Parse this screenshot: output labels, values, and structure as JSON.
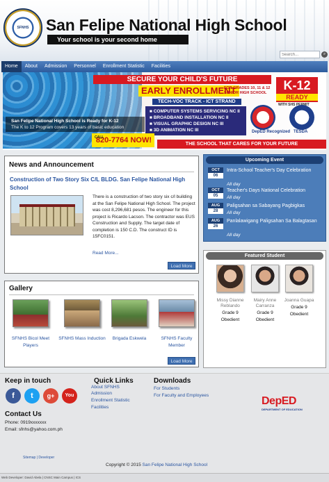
{
  "header": {
    "school_name": "San Felipe National High School",
    "tagline": "Your school is your second home",
    "search_placeholder": "Search..."
  },
  "nav": [
    "Home",
    "About",
    "Admission",
    "Personnel",
    "Enrollment Statistic",
    "Facilities"
  ],
  "banner": {
    "headline": "SECURE YOUR CHILD'S FUTURE",
    "early": "EARLY ENROLLMENT",
    "grades": "FOR GRADES 10, 11 & 12 SENIOR HIGH SCHOOL",
    "k12": "K-12",
    "k12_sub": "READY",
    "shs": "WITH SHS PERMIT",
    "strand": "TECH-VOC TRACK - ICT STRAND",
    "courses": [
      "COMPUTER SYSTEMS SERVICING NC II",
      "BROADBAND INSTALLATION NC II",
      "VISUAL GRAPHIC DESIGN NC III",
      "3D ANIMATION NC III"
    ],
    "call_label": "CALL",
    "phone": "820-7764 NOW!",
    "bottom": "THE SCHOOL THAT CARES FOR YOUR FUTURE",
    "deped_label": "DepED Recognized",
    "tesda_label": "TESDA",
    "uca_label": "UCA",
    "caption_title": "San Felipe National High School is Ready for K-12",
    "caption_sub": "The K to 12 Program covers 13 years of basic education"
  },
  "news": {
    "heading": "News and Announcement",
    "title": "Construction of Two Story Six C/L BLDG. San Felipe National High School",
    "body": "There is a construction of two story six c/l building at the San Felipe National High School. The project was cost 8,296,681 pesos. The engineer for this project is Ricardo Lacson. The contractor was EUS Construction and Supply. The target date of completion is 150 C.D. The construct ID is 15FC0151.",
    "read_more": "Read More...",
    "load_more": "Load More"
  },
  "gallery": {
    "heading": "Gallery",
    "items": [
      {
        "label": "SFNHS Bicol Meet Players"
      },
      {
        "label": "SFNHS Mass Induction"
      },
      {
        "label": "Brigada Eskwela"
      },
      {
        "label": "SFNHS Faculty Member"
      }
    ],
    "load_more": "Load More"
  },
  "events": {
    "heading": "Upcoming Event",
    "items": [
      {
        "month": "OCT",
        "day": "06",
        "title": "Intra-School Teacher's Day Celebration",
        "time": "All day"
      },
      {
        "month": "OCT",
        "day": "05",
        "title": "Teacher's Days National Celebration",
        "time": "All day"
      },
      {
        "month": "AUG",
        "day": "28",
        "title": "Paligsahan sa Sabayang Pagbigkas",
        "time": "All day"
      },
      {
        "month": "AUG",
        "day": "26",
        "title": "Panlalawigang Paligsahan Sa Balagtasan",
        "time": "All day"
      }
    ]
  },
  "featured": {
    "heading": "Featured Student",
    "students": [
      {
        "name": "Missy Dianne Reblando",
        "grade": "Grade 9",
        "status": "Obedient"
      },
      {
        "name": "Mairy Anne Carranza",
        "grade": "Grade 9",
        "status": "Obedient"
      },
      {
        "name": "Joanna Guapa",
        "grade": "Grade 9",
        "status": "Obedient"
      }
    ]
  },
  "footer": {
    "keep_in_touch": "Keep in touch",
    "quick_links": "Quick Links",
    "quick_items": [
      "About SFNHS",
      "Admission",
      "Enrollment Statistic",
      "Facilities"
    ],
    "downloads": "Downloads",
    "download_items": [
      "For Students",
      "For Faculty and Employees"
    ],
    "contact_heading": "Contact Us",
    "phone": "Phone: 0919xxxxxxx",
    "email": "Email: sfnhs@yahoo.com.ph",
    "sitemap": "Sitemap | Developer",
    "copyright": "Copyright © 2015 ",
    "copyright_link": "San Felipe National High School",
    "developer": "Web Developer: David Abela | CNSC Main Campus | ICS",
    "deped": "DepED",
    "deped_sub": "DEPARTMENT OF EDUCATION"
  },
  "social": [
    {
      "icon": "facebook-icon",
      "glyph": "f",
      "color": "#3b5998"
    },
    {
      "icon": "twitter-icon",
      "glyph": "t",
      "color": "#1da1f2"
    },
    {
      "icon": "googleplus-icon",
      "glyph": "g+",
      "color": "#dd4b39"
    },
    {
      "icon": "youtube-icon",
      "glyph": "You",
      "color": "#d4231c"
    }
  ]
}
